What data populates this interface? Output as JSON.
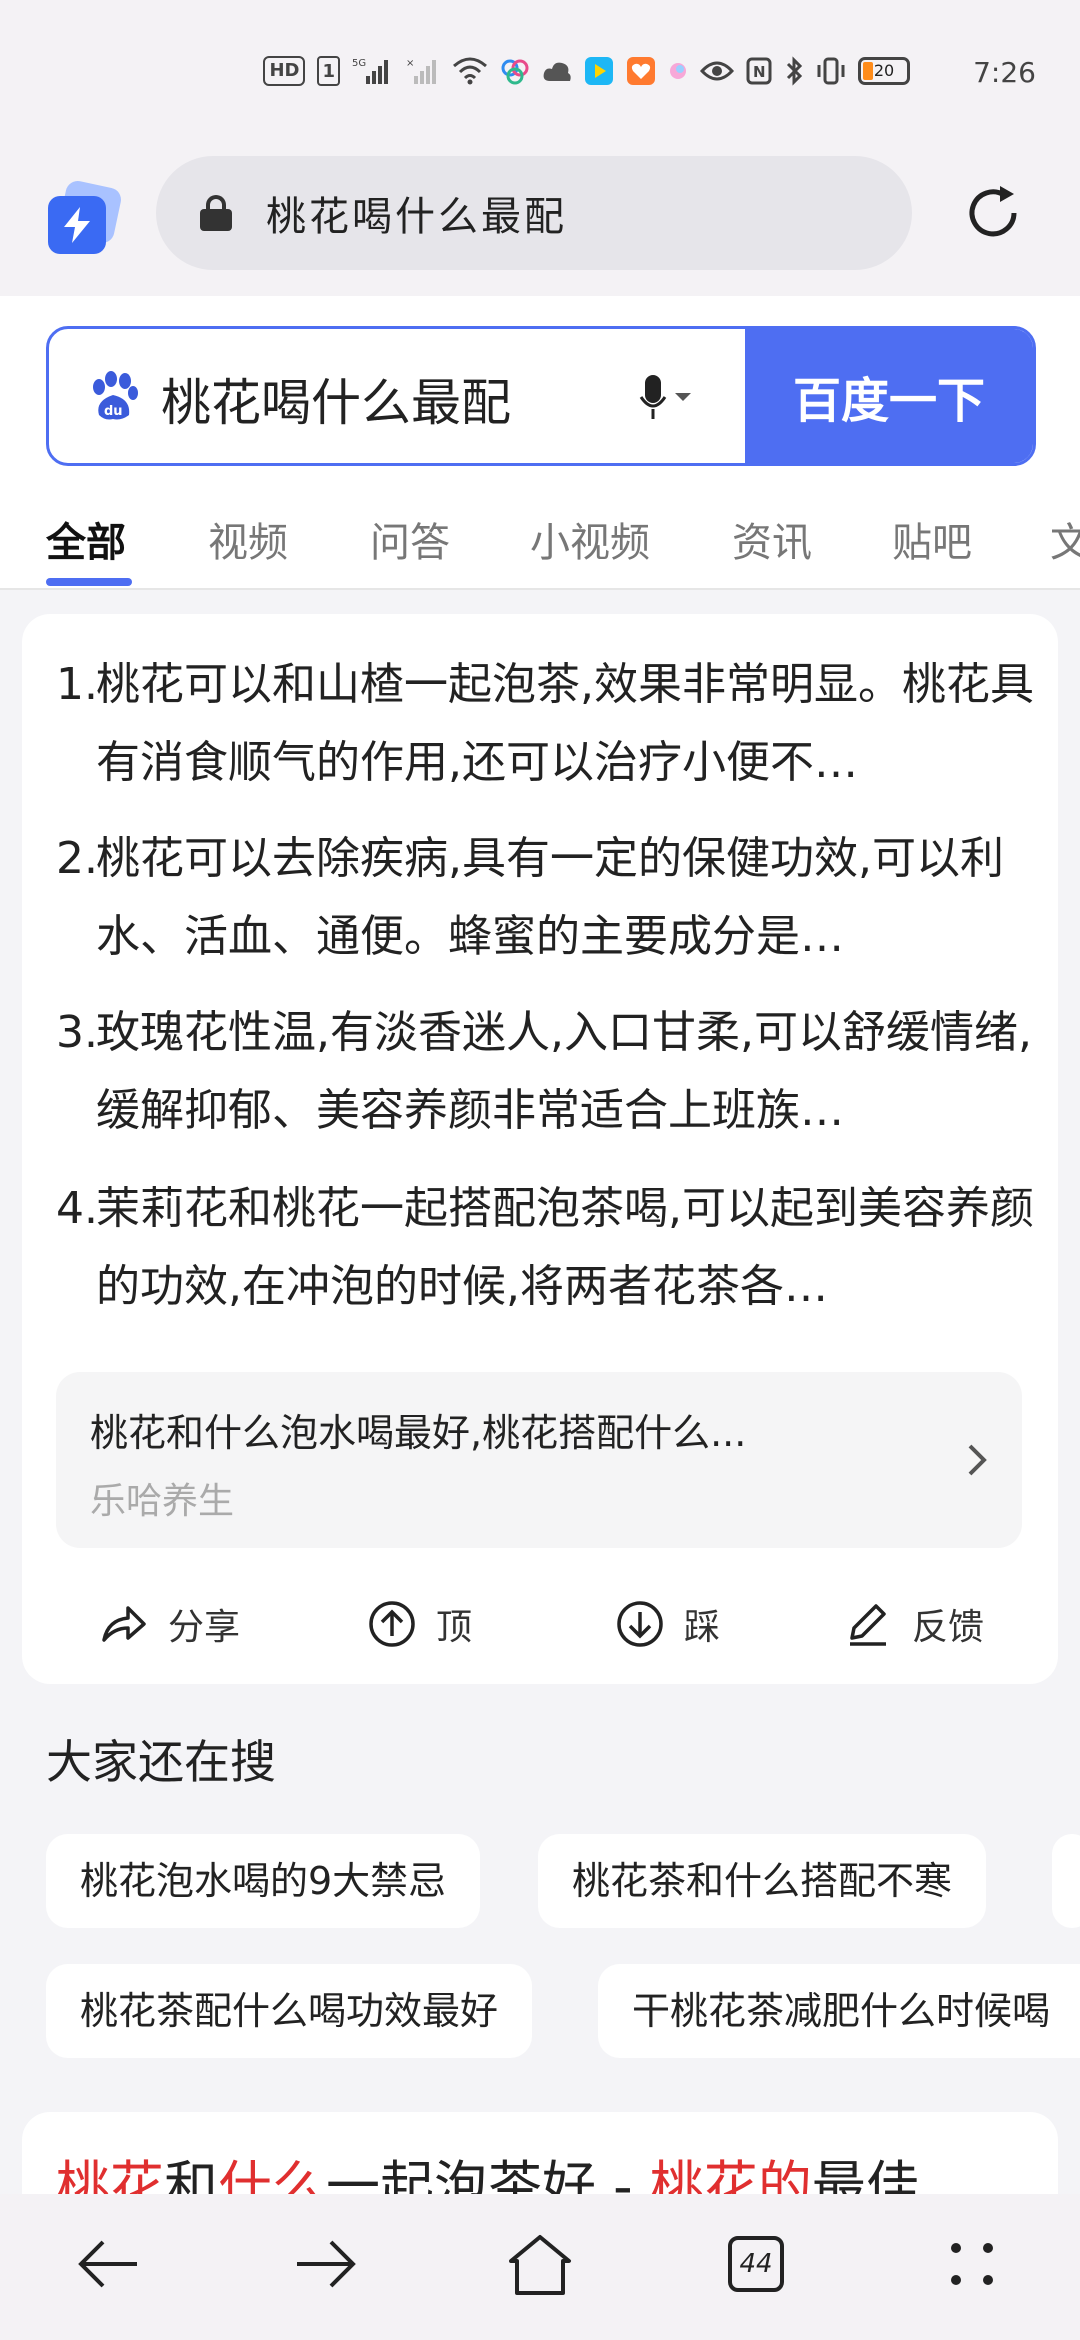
{
  "status_bar": {
    "hd_label": "HD",
    "sim_label": "1",
    "network_label": "5G",
    "battery_level": "20",
    "time": "7:26"
  },
  "browser": {
    "url_text": "桃花喝什么最配"
  },
  "search": {
    "query": "桃花喝什么最配",
    "button_label": "百度一下"
  },
  "tabs": [
    {
      "label": "全部",
      "active": true
    },
    {
      "label": "视频"
    },
    {
      "label": "问答"
    },
    {
      "label": "小视频"
    },
    {
      "label": "资讯"
    },
    {
      "label": "贴吧"
    },
    {
      "label": "文"
    }
  ],
  "answer": {
    "items": [
      {
        "num": "1.",
        "text": "桃花可以和山楂一起泡茶,效果非常明显。桃花具有消食顺气的作用,还可以治疗小便不…"
      },
      {
        "num": "2.",
        "text": "桃花可以去除疾病,具有一定的保健功效,可以利水、活血、通便。蜂蜜的主要成分是…"
      },
      {
        "num": "3.",
        "text": "玫瑰花性温,有淡香迷人,入口甘柔,可以舒缓情绪,缓解抑郁、美容养颜非常适合上班族…"
      },
      {
        "num": "4.",
        "text": "茉莉花和桃花一起搭配泡茶喝,可以起到美容养颜的功效,在冲泡的时候,将两者花茶各…"
      }
    ],
    "source_title": "桃花和什么泡水喝最好,桃花搭配什么...",
    "source_name": "乐哈养生",
    "actions": {
      "share": "分享",
      "up": "顶",
      "down": "踩",
      "feedback": "反馈"
    }
  },
  "related": {
    "title": "大家还在搜",
    "chips": [
      "桃花泡水喝的9大禁忌",
      "桃花茶和什么搭配不寒",
      "桃花茶配什么喝功效最好",
      "干桃花茶减肥什么时候喝"
    ]
  },
  "next_result": {
    "parts": [
      {
        "text": "桃花",
        "highlight": true
      },
      {
        "text": "和",
        "highlight": false
      },
      {
        "text": "什么",
        "highlight": true
      },
      {
        "text": "一起泡茶好 - ",
        "highlight": false
      },
      {
        "text": "桃花的",
        "highlight": true
      },
      {
        "text": "最佳",
        "highlight": false
      }
    ]
  },
  "bottom_nav": {
    "tab_count": "44"
  },
  "colors": {
    "accent": "#4e6ef2",
    "highlight": "#e02f2f",
    "background": "#f4f4f7"
  }
}
